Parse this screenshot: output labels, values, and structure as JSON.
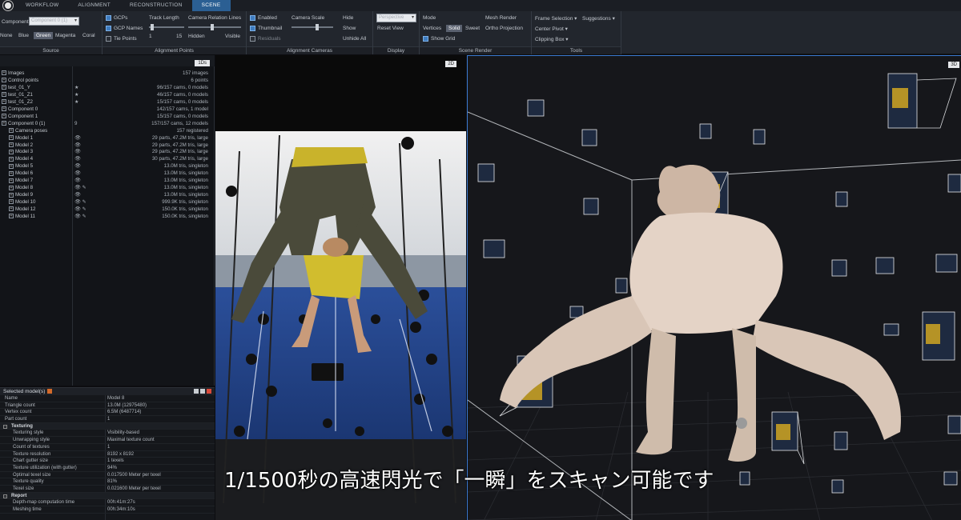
{
  "menubar": {
    "tabs": [
      {
        "label": "WORKFLOW",
        "active": false
      },
      {
        "label": "ALIGNMENT",
        "active": false
      },
      {
        "label": "RECONSTRUCTION",
        "active": false
      },
      {
        "label": "SCENE",
        "active": true
      }
    ]
  },
  "ribbon": {
    "source": {
      "title": "Source",
      "component_label": "Component",
      "component_value": "Component 0 (1)",
      "colors": [
        "None",
        "Blue",
        "Green",
        "Magenta",
        "Coral"
      ],
      "selected_color": "Green"
    },
    "alignment_points": {
      "title": "Alignment Points",
      "gcps": "GCPs",
      "gcp_names": "GCP Names",
      "tie_points": "Tie Points",
      "track_length": "Track Length",
      "track_min": "1",
      "track_max": "15",
      "camera_relation_lines": "Camera Relation Lines",
      "hidden": "Hidden",
      "visible": "Visible"
    },
    "alignment_cameras": {
      "title": "Alignment Cameras",
      "enabled": "Enabled",
      "thumbnail": "Thumbnail",
      "residuals": "Residuals",
      "camera_scale": "Camera Scale",
      "hide": "Hide",
      "show": "Show",
      "unhide_all": "Unhide All"
    },
    "display": {
      "title": "Display",
      "view_value": "Perspective",
      "reset_view": "Reset View"
    },
    "scene_render": {
      "title": "Scene Render",
      "mode": "Mode",
      "vertices": "Vertices",
      "solid": "Solid",
      "sweet": "Sweet",
      "show_grid": "Show Grid",
      "mesh_render": "Mesh Render",
      "ortho_projection": "Ortho Projection"
    },
    "tools": {
      "title": "Tools",
      "frame_selection": "Frame Selection",
      "suggestions": "Suggestions",
      "center_pivot": "Center Pivot",
      "clipping_box": "Clipping Box"
    }
  },
  "tree": {
    "button": "1Ds",
    "rows": [
      {
        "name": "Images",
        "flag": "",
        "value": "157 images",
        "indent": 0
      },
      {
        "name": "Control points",
        "flag": "",
        "value": "6 points",
        "indent": 0
      },
      {
        "name": "test_01_Y",
        "flag": "★",
        "value": "96/157 cams, 0 models",
        "indent": 0
      },
      {
        "name": "test_01_Z1",
        "flag": "★",
        "value": "46/157 cams, 0 models",
        "indent": 0
      },
      {
        "name": "test_01_Z2",
        "flag": "★",
        "value": "15/157 cams, 0 models",
        "indent": 0
      },
      {
        "name": "Component 0",
        "flag": "",
        "value": "142/157 cams, 1 model",
        "indent": 0
      },
      {
        "name": "Component 1",
        "flag": "",
        "value": "15/157 cams, 0 models",
        "indent": 0
      },
      {
        "name": "Component 0 (1)",
        "flag": "9",
        "value": "157/157 cams, 12 models",
        "indent": 0
      },
      {
        "name": "Camera poses",
        "flag": "",
        "value": "157 registered",
        "indent": 1
      },
      {
        "name": "Model 1",
        "flag": "👁",
        "value": "29 parts, 47.2M tris, large",
        "indent": 1
      },
      {
        "name": "Model 2",
        "flag": "👁",
        "value": "29 parts, 47.2M tris, large",
        "indent": 1
      },
      {
        "name": "Model 3",
        "flag": "👁",
        "value": "29 parts, 47.2M tris, large",
        "indent": 1
      },
      {
        "name": "Model 4",
        "flag": "👁",
        "value": "30 parts, 47.2M tris, large",
        "indent": 1
      },
      {
        "name": "Model 5",
        "flag": "👁",
        "value": "13.0M tris, singleton",
        "indent": 1
      },
      {
        "name": "Model 6",
        "flag": "👁",
        "value": "13.0M tris, singleton",
        "indent": 1
      },
      {
        "name": "Model 7",
        "flag": "👁",
        "value": "13.0M tris, singleton",
        "indent": 1
      },
      {
        "name": "Model 8",
        "flag": "👁 ✎",
        "value": "13.0M tris, singleton",
        "indent": 1
      },
      {
        "name": "Model 9",
        "flag": "👁",
        "value": "13.0M tris, singleton",
        "indent": 1
      },
      {
        "name": "Model 10",
        "flag": "👁 ✎",
        "value": "999.9K tris, singleton",
        "indent": 1
      },
      {
        "name": "Model 12",
        "flag": "👁 ✎",
        "value": "150.0K tris, singleton",
        "indent": 1
      },
      {
        "name": "Model 11",
        "flag": "👁 ✎",
        "value": "150.0K tris, singleton",
        "indent": 1
      }
    ]
  },
  "selected": {
    "title": "Selected model(s)",
    "rows": [
      {
        "k": "Name",
        "v": "Model 8",
        "type": "row"
      },
      {
        "k": "Triangle count",
        "v": "13.0M (12975480)",
        "type": "row"
      },
      {
        "k": "Vertex count",
        "v": "6.5M (6487714)",
        "type": "row"
      },
      {
        "k": "Part count",
        "v": "1",
        "type": "row"
      },
      {
        "k": "Texturing",
        "v": "",
        "type": "sec"
      },
      {
        "k": "Texturing style",
        "v": "Visibility-based",
        "type": "sub"
      },
      {
        "k": "Unwrapping style",
        "v": "Maximal texture count",
        "type": "sub"
      },
      {
        "k": "Count of textures",
        "v": "1",
        "type": "sub"
      },
      {
        "k": "Texture resolution",
        "v": "8192 x 8192",
        "type": "sub"
      },
      {
        "k": "Chart gutter size",
        "v": "1 texels",
        "type": "sub"
      },
      {
        "k": "Texture utilization (with gutter)",
        "v": "94%",
        "type": "sub"
      },
      {
        "k": "Optimal texel size",
        "v": "0.017500 Meter per texel",
        "type": "sub"
      },
      {
        "k": "Texture quality",
        "v": "81%",
        "type": "sub"
      },
      {
        "k": "Texel size",
        "v": "0.021600 Meter per texel",
        "type": "sub"
      },
      {
        "k": "Report",
        "v": "",
        "type": "sec"
      },
      {
        "k": "Depth-map computation time",
        "v": "00h:41m:27s",
        "type": "sub"
      },
      {
        "k": "Meshing time",
        "v": "00h:34m:10s",
        "type": "sub"
      }
    ]
  },
  "view2d": {
    "badge": "2D"
  },
  "view3d": {
    "badge": "3D"
  },
  "subtitle": "1/1500秒の高速閃光で「一瞬」をスキャン可能です"
}
